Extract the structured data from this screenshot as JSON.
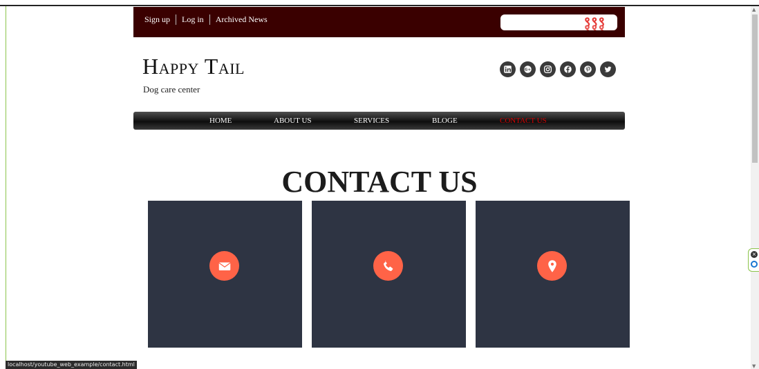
{
  "topbar": {
    "links": [
      "Sign up",
      "Log in",
      "Archived News"
    ],
    "captcha": "९९९"
  },
  "brand": {
    "title": "Happy Tail",
    "subtitle": "Dog care center"
  },
  "socials": [
    "linkedin-icon",
    "google-plus-icon",
    "instagram-icon",
    "facebook-icon",
    "pinterest-icon",
    "twitter-icon"
  ],
  "nav": {
    "items": [
      "HOME",
      "ABOUT US",
      "SERVICES",
      "BLOGE",
      "CONTACT US"
    ],
    "active": "CONTACT US",
    "active_color": "#d50000"
  },
  "page": {
    "heading": "CONTACT US"
  },
  "cards": [
    {
      "icon": "envelope-icon"
    },
    {
      "icon": "phone-icon"
    },
    {
      "icon": "map-marker-icon"
    }
  ],
  "colors": {
    "topbar_bg": "#3a0000",
    "card_bg": "#2e3443",
    "icon_circle": "#ff6347"
  },
  "status_bar": {
    "url": "localhost/youtube_web_example/contact.html"
  }
}
